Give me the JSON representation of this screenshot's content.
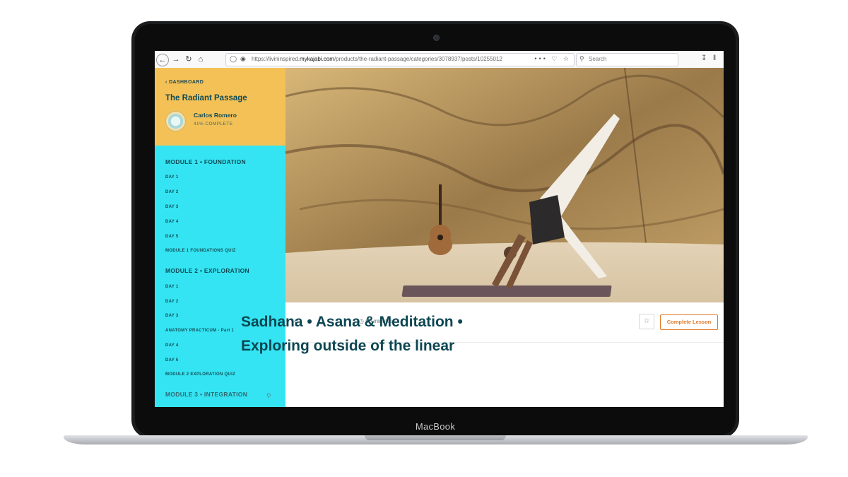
{
  "device": {
    "brand": "MacBook"
  },
  "browser": {
    "url_prefix": "https://livininspired.",
    "url_host": "mykajabi.com",
    "url_path": "/products/the-radiant-passage/categories/3078937/posts/10255012",
    "url_actions": "••• ♡ ☆",
    "search_placeholder": "Search"
  },
  "sidebar": {
    "back_label": "DASHBOARD",
    "course_title": "The Radiant Passage",
    "user_name": "Carlos Romero",
    "progress": "41% COMPLETE",
    "progress_fraction": 0.41,
    "modules": [
      {
        "title": "MODULE 1 • FOUNDATION",
        "items": [
          "DAY 1",
          "DAY 2",
          "DAY 3",
          "DAY 4",
          "DAY 5",
          "MODULE 1 FOUNDATIONS QUIZ"
        ]
      },
      {
        "title": "MODULE 2 • EXPLORATION",
        "items": [
          "DAY 1",
          "DAY 2",
          "DAY 3",
          "ANATOMY PRACTICUM - Part 1",
          "DAY 4",
          "DAY 5",
          "MODULE 2 EXPLORATION QUIZ"
        ]
      },
      {
        "title": "MODULE 3 • INTEGRATION",
        "items": []
      }
    ]
  },
  "lesson": {
    "duration": "60 minutes",
    "complete_label": "Complete Lesson",
    "title_line1": "Sadhana • Asana & Meditation •",
    "title_line2": "Exploring outside of the linear"
  },
  "colors": {
    "sidebar_bg": "#34e4f2",
    "sidebar_header_bg": "#f4c157",
    "title_color": "#0c4652",
    "accent_orange": "#e2792a"
  }
}
